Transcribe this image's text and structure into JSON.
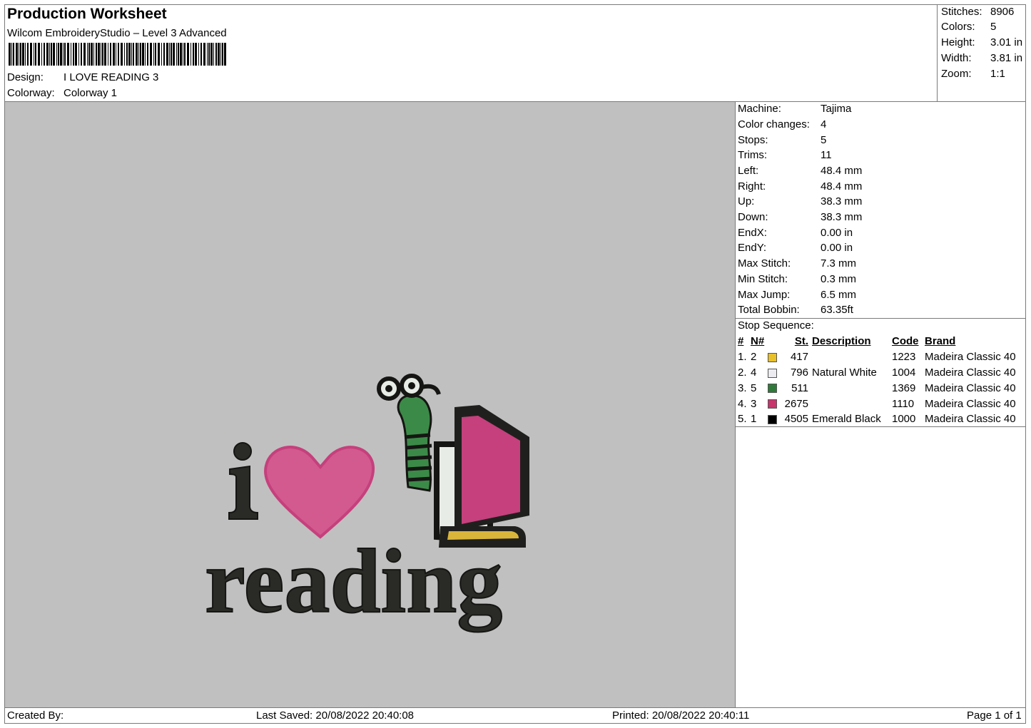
{
  "header": {
    "title": "Production Worksheet",
    "software": "Wilcom EmbroideryStudio – Level 3 Advanced",
    "design_label": "Design:",
    "design_value": "I LOVE READING 3",
    "colorway_label": "Colorway:",
    "colorway_value": "Colorway 1"
  },
  "summary": [
    {
      "label": "Stitches:",
      "value": "8906"
    },
    {
      "label": "Colors:",
      "value": "5"
    },
    {
      "label": "Height:",
      "value": "3.01 in"
    },
    {
      "label": "Width:",
      "value": "3.81 in"
    },
    {
      "label": "Zoom:",
      "value": "1:1"
    }
  ],
  "machine_info": [
    {
      "label": "Machine:",
      "value": "Tajima"
    },
    {
      "label": "Color changes:",
      "value": "4"
    },
    {
      "label": "Stops:",
      "value": "5"
    },
    {
      "label": "Trims:",
      "value": "11"
    },
    {
      "label": "Left:",
      "value": "48.4 mm"
    },
    {
      "label": "Right:",
      "value": "48.4 mm"
    },
    {
      "label": "Up:",
      "value": "38.3 mm"
    },
    {
      "label": "Down:",
      "value": "38.3 mm"
    },
    {
      "label": "EndX:",
      "value": "0.00 in"
    },
    {
      "label": "EndY:",
      "value": "0.00 in"
    },
    {
      "label": "Max Stitch:",
      "value": "7.3 mm"
    },
    {
      "label": "Min Stitch:",
      "value": "0.3 mm"
    },
    {
      "label": "Max Jump:",
      "value": "6.5 mm"
    },
    {
      "label": "Total Bobbin:",
      "value": "63.35ft"
    }
  ],
  "stop_sequence": {
    "title": "Stop Sequence:",
    "headers": {
      "num": "#",
      "n": "N#",
      "st": "St.",
      "desc": "Description",
      "code": "Code",
      "brand": "Brand"
    },
    "rows": [
      {
        "num": "1.",
        "n": "2",
        "color": "#e8c02a",
        "st": "417",
        "desc": "",
        "code": "1223",
        "brand": "Madeira Classic 40"
      },
      {
        "num": "2.",
        "n": "4",
        "color": "#ecebf0",
        "st": "796",
        "desc": "Natural White",
        "code": "1004",
        "brand": "Madeira Classic 40"
      },
      {
        "num": "3.",
        "n": "5",
        "color": "#2f7a3a",
        "st": "511",
        "desc": "",
        "code": "1369",
        "brand": "Madeira Classic 40"
      },
      {
        "num": "4.",
        "n": "3",
        "color": "#c8346c",
        "st": "2675",
        "desc": "",
        "code": "1110",
        "brand": "Madeira Classic 40"
      },
      {
        "num": "5.",
        "n": "1",
        "color": "#000000",
        "st": "4505",
        "desc": "Emerald Black",
        "code": "1000",
        "brand": "Madeira Classic 40"
      }
    ]
  },
  "design": {
    "letter_i": "i",
    "word": "reading",
    "colors": {
      "black": "#2a2b27",
      "pink": "#d35a8f",
      "pink_dark": "#c5407c",
      "green": "#3c8a48",
      "white": "#e7ece6",
      "yellow": "#d9b53a",
      "canvas": "#c0c0c0"
    }
  },
  "footer": {
    "created_by": "Created By:",
    "last_saved": "Last Saved: 20/08/2022 20:40:08",
    "printed": "Printed: 20/08/2022 20:40:11",
    "page": "Page 1 of 1"
  }
}
